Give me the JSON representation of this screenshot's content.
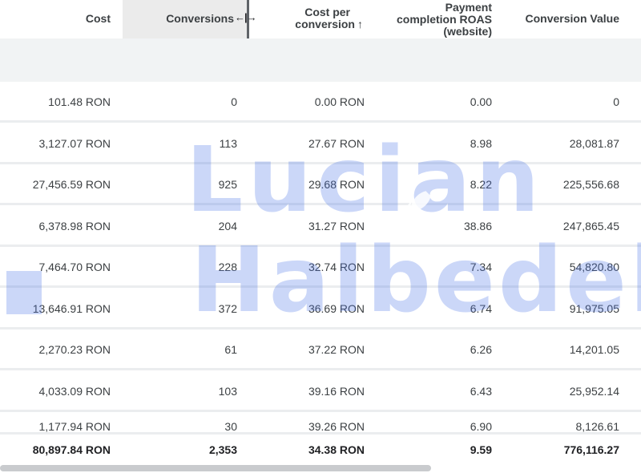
{
  "columns": {
    "cost": "Cost",
    "conversions": "Conversions",
    "cost_per_conversion_line1": "Cost per",
    "cost_per_conversion_line2": "conversion",
    "roas_line1": "Payment",
    "roas_line2": "completion ROAS",
    "roas_line3": "(website)",
    "conversion_value": "Conversion Value"
  },
  "sort_indicator": "↑",
  "resize_indicator": "←|→",
  "rows": [
    {
      "cost": "101.48 RON",
      "conversions": "0",
      "cost_per_conversion": "0.00 RON",
      "roas": "0.00",
      "conversion_value": "0"
    },
    {
      "cost": "3,127.07 RON",
      "conversions": "113",
      "cost_per_conversion": "27.67 RON",
      "roas": "8.98",
      "conversion_value": "28,081.87"
    },
    {
      "cost": "27,456.59 RON",
      "conversions": "925",
      "cost_per_conversion": "29.68 RON",
      "roas": "8.22",
      "conversion_value": "225,556.68"
    },
    {
      "cost": "6,378.98 RON",
      "conversions": "204",
      "cost_per_conversion": "31.27 RON",
      "roas": "38.86",
      "conversion_value": "247,865.45"
    },
    {
      "cost": "7,464.70 RON",
      "conversions": "228",
      "cost_per_conversion": "32.74 RON",
      "roas": "7.34",
      "conversion_value": "54,820.80"
    },
    {
      "cost": "13,646.91 RON",
      "conversions": "372",
      "cost_per_conversion": "36.69 RON",
      "roas": "6.74",
      "conversion_value": "91,975.05"
    },
    {
      "cost": "2,270.23 RON",
      "conversions": "61",
      "cost_per_conversion": "37.22 RON",
      "roas": "6.26",
      "conversion_value": "14,201.05"
    },
    {
      "cost": "4,033.09 RON",
      "conversions": "103",
      "cost_per_conversion": "39.16 RON",
      "roas": "6.43",
      "conversion_value": "25,952.14"
    },
    {
      "cost": "1,177.94 RON",
      "conversions": "30",
      "cost_per_conversion": "39.26 RON",
      "roas": "6.90",
      "conversion_value": "8,126.61"
    }
  ],
  "totals": {
    "cost": "80,897.84 RON",
    "conversions": "2,353",
    "cost_per_conversion": "34.38 RON",
    "roas": "9.59",
    "conversion_value": "776,116.27"
  },
  "watermark": {
    "line1": "Lucian",
    "line2": "Halbedel",
    "color": "#466ee6"
  }
}
